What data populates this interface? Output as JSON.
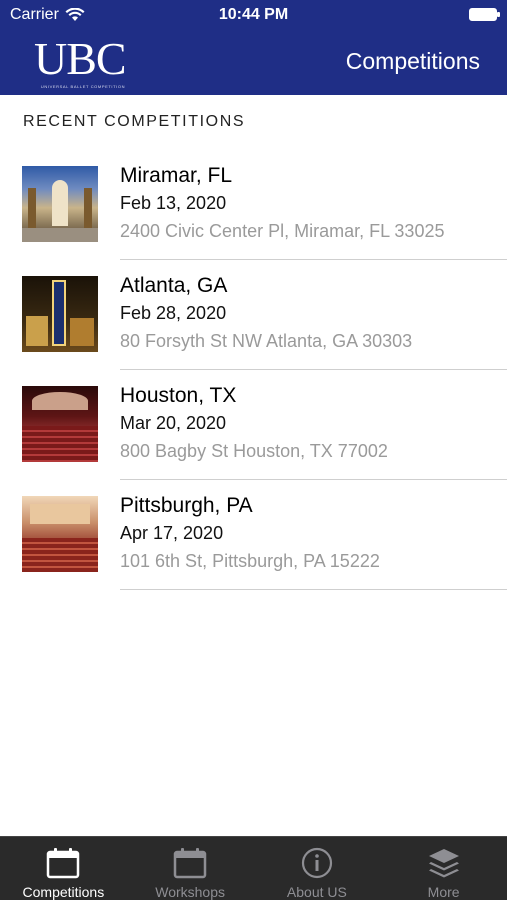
{
  "status_bar": {
    "carrier": "Carrier",
    "time": "10:44 PM"
  },
  "header": {
    "logo_letters": "UBC",
    "logo_tagline": "UNIVERSAL BALLET COMPETITION",
    "title": "Competitions"
  },
  "section": {
    "title": "RECENT COMPETITIONS"
  },
  "competitions": [
    {
      "city": "Miramar, FL",
      "date": "Feb 13, 2020",
      "address": "2400 Civic Center Pl, Miramar, FL 33025"
    },
    {
      "city": "Atlanta, GA",
      "date": "Feb 28, 2020",
      "address": "80 Forsyth St NW Atlanta, GA 30303"
    },
    {
      "city": "Houston, TX",
      "date": "Mar 20, 2020",
      "address": "800 Bagby St Houston, TX 77002"
    },
    {
      "city": "Pittsburgh, PA",
      "date": "Apr 17, 2020",
      "address": "101 6th St, Pittsburgh, PA 15222"
    }
  ],
  "tabs": [
    {
      "label": "Competitions",
      "icon": "calendar-icon",
      "active": true
    },
    {
      "label": "Workshops",
      "icon": "calendar-icon",
      "active": false
    },
    {
      "label": "About US",
      "icon": "info-icon",
      "active": false
    },
    {
      "label": "More",
      "icon": "layers-icon",
      "active": false
    }
  ],
  "colors": {
    "header_bg": "#1f2e86",
    "tabbar_bg": "#2a2a2a",
    "address_text": "#9a9a9a"
  }
}
